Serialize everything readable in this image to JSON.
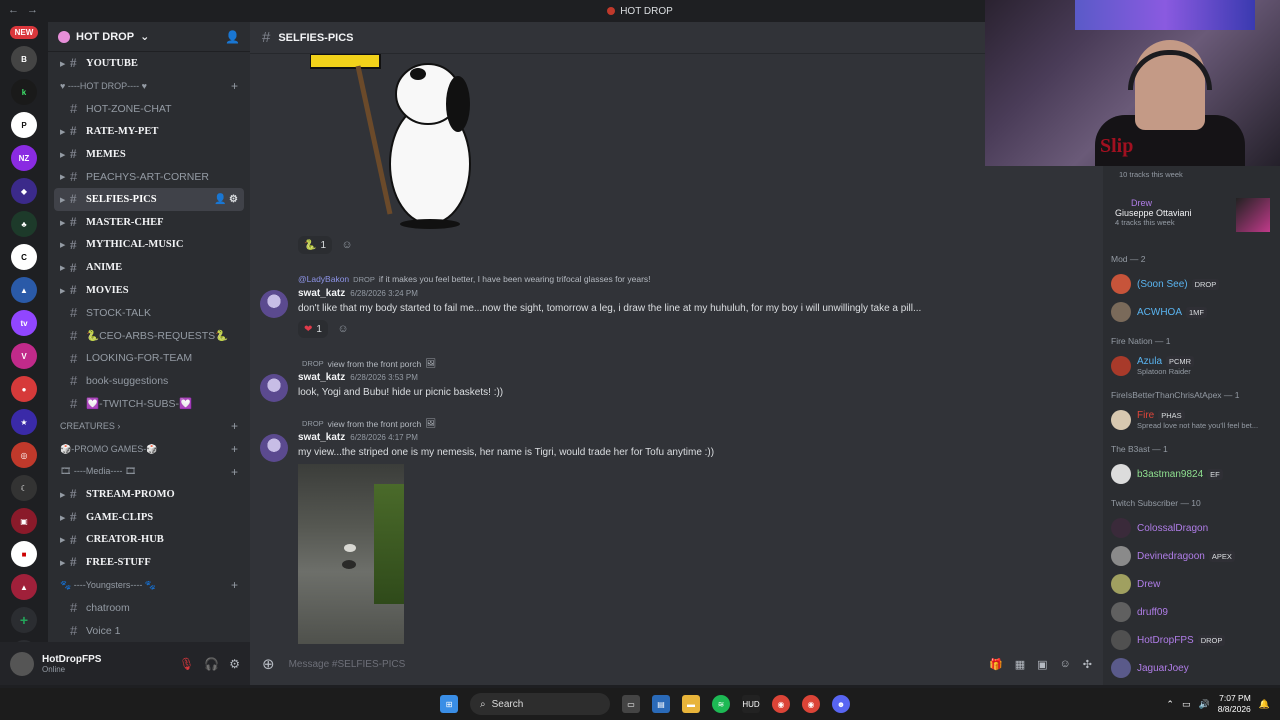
{
  "titlebar": {
    "title": "HOT DROP"
  },
  "rail": {
    "new_badge": "NEW"
  },
  "server": {
    "name": "HOT DROP"
  },
  "channels": [
    {
      "type": "channel",
      "label": "YOUTUBE",
      "bold": true,
      "arrow": true
    },
    {
      "type": "category",
      "label": "♥ ----HOT DROP---- ♥"
    },
    {
      "type": "channel",
      "label": "HOT-ZONE-CHAT",
      "bold": false,
      "arrow": false
    },
    {
      "type": "channel",
      "label": "RATE-MY-PET",
      "bold": true,
      "arrow": true
    },
    {
      "type": "channel",
      "label": "MEMES",
      "bold": true,
      "arrow": true
    },
    {
      "type": "channel",
      "label": "PEACHYS-ART-CORNER",
      "bold": false,
      "arrow": true
    },
    {
      "type": "channel",
      "label": "SELFIES-PICS",
      "bold": true,
      "arrow": true,
      "selected": true
    },
    {
      "type": "channel",
      "label": "MASTER-CHEF",
      "bold": true,
      "arrow": true
    },
    {
      "type": "channel",
      "label": "MYTHICAL-MUSIC",
      "bold": true,
      "arrow": true
    },
    {
      "type": "channel",
      "label": "ANIME",
      "bold": true,
      "arrow": true
    },
    {
      "type": "channel",
      "label": "MOVIES",
      "bold": true,
      "arrow": true
    },
    {
      "type": "channel",
      "label": "STOCK-TALK",
      "bold": false,
      "arrow": false
    },
    {
      "type": "channel",
      "label": "🐍CEO-ARBS-REQUESTS🐍",
      "bold": false,
      "arrow": false
    },
    {
      "type": "channel",
      "label": "LOOKING-FOR-TEAM",
      "bold": false,
      "arrow": false
    },
    {
      "type": "channel",
      "label": "book-suggestions",
      "bold": false,
      "arrow": false
    },
    {
      "type": "channel",
      "label": "💟-TWITCH-SUBS-💟",
      "bold": false,
      "arrow": false
    },
    {
      "type": "category",
      "label": "CREATURES ›"
    },
    {
      "type": "category",
      "label": "🎲-PROMO GAMES-🎲"
    },
    {
      "type": "category",
      "label": "🎞 ----Media---- 🎞"
    },
    {
      "type": "channel",
      "label": "STREAM-PROMO",
      "bold": true,
      "arrow": true
    },
    {
      "type": "channel",
      "label": "GAME-CLIPS",
      "bold": true,
      "arrow": true
    },
    {
      "type": "channel",
      "label": "CREATOR-HUB",
      "bold": true,
      "arrow": true
    },
    {
      "type": "channel",
      "label": "FREE-STUFF",
      "bold": true,
      "arrow": true
    },
    {
      "type": "category",
      "label": "🐾 ----Youngsters---- 🐾"
    },
    {
      "type": "channel",
      "label": "chatroom",
      "bold": false,
      "arrow": false
    },
    {
      "type": "channel",
      "label": "Voice 1",
      "bold": false,
      "arrow": false
    }
  ],
  "user": {
    "name": "HotDropFPS",
    "status": "Online"
  },
  "chat": {
    "channel": "SELFIES-PICS",
    "reaction_top": "1",
    "composer_placeholder": "Message #SELFIES-PICS",
    "messages": [
      {
        "reply_name": "@LadyBakon",
        "reply_tag": "DROP",
        "reply_text": "if it makes you feel better, I have been wearing trifocal glasses for years!",
        "author": "swat_katz",
        "time": "6/28/2026 3:24 PM",
        "text": "don't like that my body started to fail me...now the sight, tomorrow a leg, i draw the line at my huhuluh, for my boy i will unwillingly take a pill...",
        "reaction": "1"
      },
      {
        "reply_name": "",
        "reply_tag": "DROP",
        "reply_text": "view from the front porch",
        "author": "swat_katz",
        "time": "6/28/2026 3:53 PM",
        "text": "look, Yogi and Bubu! hide ur picnic baskets! :))"
      },
      {
        "reply_name": "",
        "reply_tag": "DROP",
        "reply_text": "view from the front porch",
        "author": "swat_katz",
        "time": "6/28/2026 4:17 PM",
        "text": "my view...the striped one is my nemesis, her name is Tigri, would trade her for Tofu anytime :))"
      }
    ]
  },
  "members": {
    "top_tracks": "10 tracks this week",
    "drew": {
      "name": "Drew",
      "song": "Giuseppe Ottaviani",
      "tracks": "4 tracks this week"
    },
    "groups": [
      {
        "title": "Mod — 2",
        "items": [
          {
            "name": "(Soon See)",
            "badge": "DROP",
            "color": "#5ab4f0",
            "avatar": "#c7543a"
          },
          {
            "name": "ACWHOA",
            "badge": "1MF",
            "color": "#5ab4f0",
            "avatar": "#7a6a5a"
          }
        ]
      },
      {
        "title": "Fire Nation — 1",
        "items": [
          {
            "name": "Azula",
            "badge": "PCMR",
            "sub": "Splatoon Raider",
            "color": "#5ab4f0",
            "avatar": "#a83a2a"
          }
        ]
      },
      {
        "title": "FireIsBetterThanChrisAtApex — 1",
        "items": [
          {
            "name": "Fire",
            "badge": "PHAS",
            "sub": "Spread love not hate you'll feel bet...",
            "color": "#e0453a",
            "avatar": "#d8c8b0"
          }
        ]
      },
      {
        "title": "The B3ast — 1",
        "items": [
          {
            "name": "b3astman9824",
            "badge": "EF",
            "color": "#8fe08f",
            "avatar": "#dcdcdc"
          }
        ]
      },
      {
        "title": "Twitch Subscriber — 10",
        "items": [
          {
            "name": "ColossalDragon",
            "color": "#b07de8",
            "avatar": "#3a2a3a"
          },
          {
            "name": "Devinedragoon",
            "badge": "APEX",
            "color": "#b07de8",
            "avatar": "#8a8a8a"
          },
          {
            "name": "Drew",
            "color": "#b07de8",
            "avatar": "#a0a060"
          },
          {
            "name": "druff09",
            "color": "#b07de8",
            "avatar": "#606060"
          },
          {
            "name": "HotDropFPS",
            "badge": "DROP",
            "color": "#b07de8",
            "avatar": "#505050"
          },
          {
            "name": "JaguarJoey",
            "color": "#b07de8",
            "avatar": "#5a5a8a"
          }
        ]
      }
    ]
  },
  "taskbar": {
    "search": "Search",
    "time": "7:07 PM",
    "date": "8/8/2026"
  }
}
